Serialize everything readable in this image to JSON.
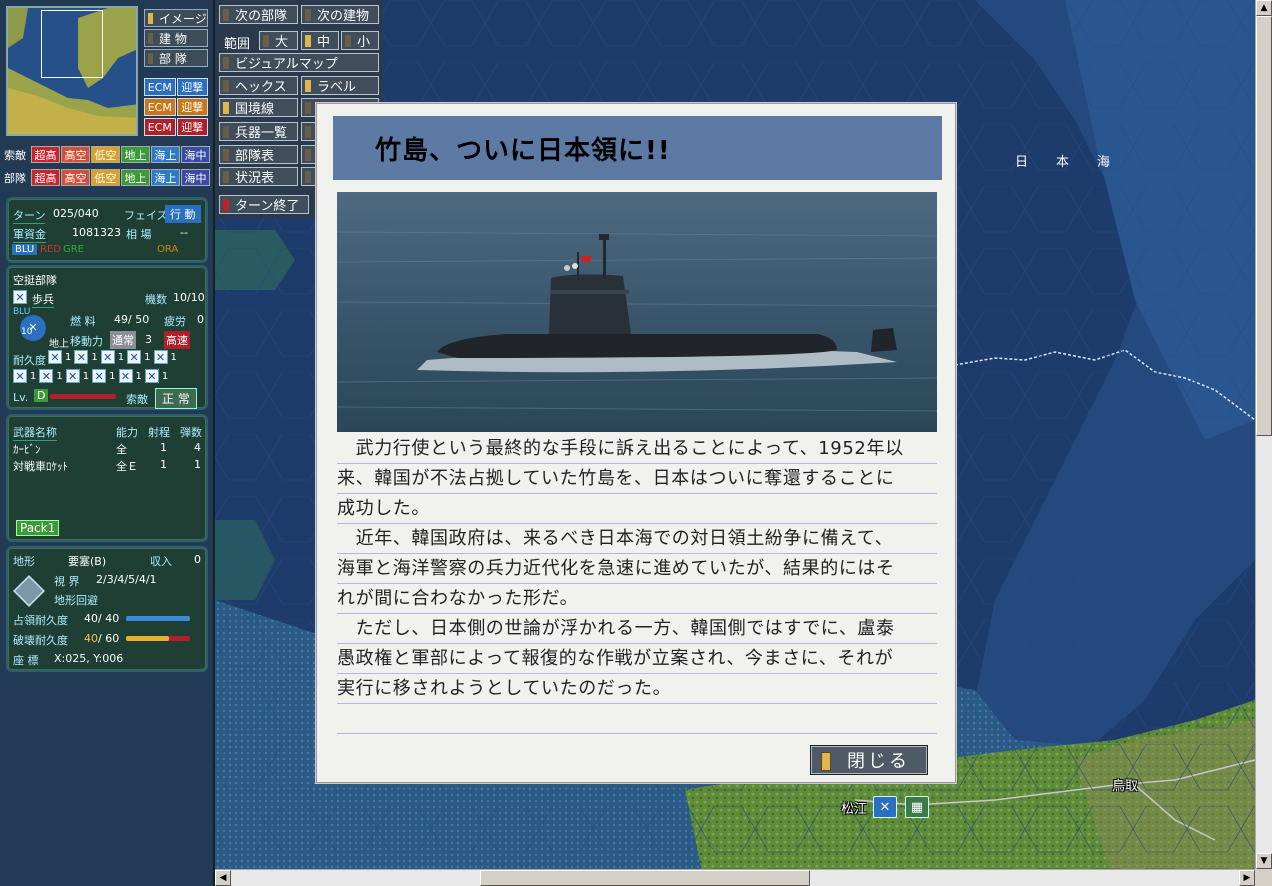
{
  "map": {
    "sea_label": "日本海",
    "cities": [
      {
        "name": "松江"
      },
      {
        "name": "鳥取"
      }
    ]
  },
  "left_panel": {
    "view_buttons": [
      {
        "label": "イメージ",
        "on": true
      },
      {
        "label": "建 物",
        "on": false
      },
      {
        "label": "部 隊",
        "on": false
      }
    ],
    "ecm": [
      {
        "ecm": "ECM",
        "intercept": "迎撃",
        "color": "#2a6fc0"
      },
      {
        "ecm": "ECM",
        "intercept": "迎撃",
        "color": "#c8781a"
      },
      {
        "ecm": "ECM",
        "intercept": "迎撃",
        "color": "#b0202a"
      }
    ],
    "search_row": {
      "label": "索敵",
      "items": [
        "超高",
        "高空",
        "低空",
        "地上",
        "海上",
        "海中"
      ]
    },
    "unit_row": {
      "label": "部隊",
      "items": [
        "超高",
        "高空",
        "低空",
        "地上",
        "海上",
        "海中"
      ]
    },
    "toggle_colors": [
      "#c8262e",
      "#d2503a",
      "#d8a22a",
      "#3c9a3a",
      "#2f7bc8",
      "#3a4aa8"
    ],
    "turn": {
      "turn_label": "ターン",
      "turn_value": "025/040",
      "phase_label": "フェイズ",
      "phase_value": "行 動",
      "funds_label": "軍資金",
      "funds_value": "1081323",
      "market_label": "相 場",
      "market_value": "--",
      "factions": [
        "BLU",
        "RED",
        "GRE",
        "ORA"
      ]
    },
    "unit": {
      "type": "空挺部隊",
      "name": "歩兵",
      "count_label": "機数",
      "count_value": "10/10",
      "faction": "BLU",
      "num": "10",
      "domain": "地上",
      "fuel_label": "燃 料",
      "fuel_value": "49/ 50",
      "fatigue_label": "疲労",
      "fatigue_value": "0",
      "move_label": "移動力",
      "move_mode": "通常",
      "move_value": "3",
      "move_fast": "高速",
      "durability_label": "耐久度",
      "durability_values": [
        "1",
        "1",
        "1",
        "1",
        "1",
        "1",
        "1",
        "1",
        "1",
        "1",
        "1",
        "1"
      ],
      "lv_label": "Lv.",
      "lv_value": "D",
      "search_label": "索敵",
      "status_value": "正 常"
    },
    "weapons": {
      "headers": [
        "武器名称",
        "能力",
        "射程",
        "弾数"
      ],
      "rows": [
        {
          "name": "ｶｰﾋﾞﾝ",
          "ability": "全",
          "range": "1",
          "ammo": "4"
        },
        {
          "name": "対戦車ﾛｹｯﾄ",
          "ability": "全Ｅ",
          "range": "1",
          "ammo": "1"
        }
      ],
      "pack": "Pack1"
    },
    "terrain": {
      "label": "地形",
      "value": "要塞(B)",
      "income_label": "収入",
      "income_value": "0",
      "sight_label": "視 界",
      "sight_value": "2/3/4/5/4/1",
      "evade_label": "地形回避",
      "occupy_label": "占領耐久度",
      "occupy_value": "40/ 40",
      "occupy_fraction": 1.0,
      "destroy_label": "破壊耐久度",
      "destroy_current": "40",
      "destroy_max": "/ 60",
      "destroy_fraction": 0.667,
      "coord_label": "座 標",
      "coord_value": "X:025, Y:006"
    }
  },
  "commands": {
    "next_unit": "次の部隊",
    "next_building": "次の建物",
    "range_label": "範囲",
    "range_large": "大",
    "range_mid": "中",
    "range_small": "小",
    "visual_map": "ビジュアルマップ",
    "hex": "ヘックス",
    "label": "ラベル",
    "border": "国境線",
    "weapons_list": "兵器一覧",
    "unit_table": "部隊表",
    "status_table": "状況表",
    "end_turn": "ターン終了"
  },
  "dialog": {
    "title": "竹島、ついに日本領に!!",
    "lines": [
      "　武力行使という最終的な手段に訴え出ることによって、1952年以",
      "来、韓国が不法占拠していた竹島を、日本はついに奪還することに",
      "成功した。",
      "　近年、韓国政府は、来るべき日本海での対日領土紛争に備えて、",
      "海軍と海洋警察の兵力近代化を急速に進めていたが、結果的にはそ",
      "れが間に合わなかった形だ。",
      "　ただし、日本側の世論が浮かれる一方、韓国側ではすでに、盧泰",
      "愚政権と軍部によって報復的な作戦が立案され、今まさに、それが",
      "実行に移されようとしていたのだった。",
      ""
    ],
    "close_label": "閉じる"
  }
}
